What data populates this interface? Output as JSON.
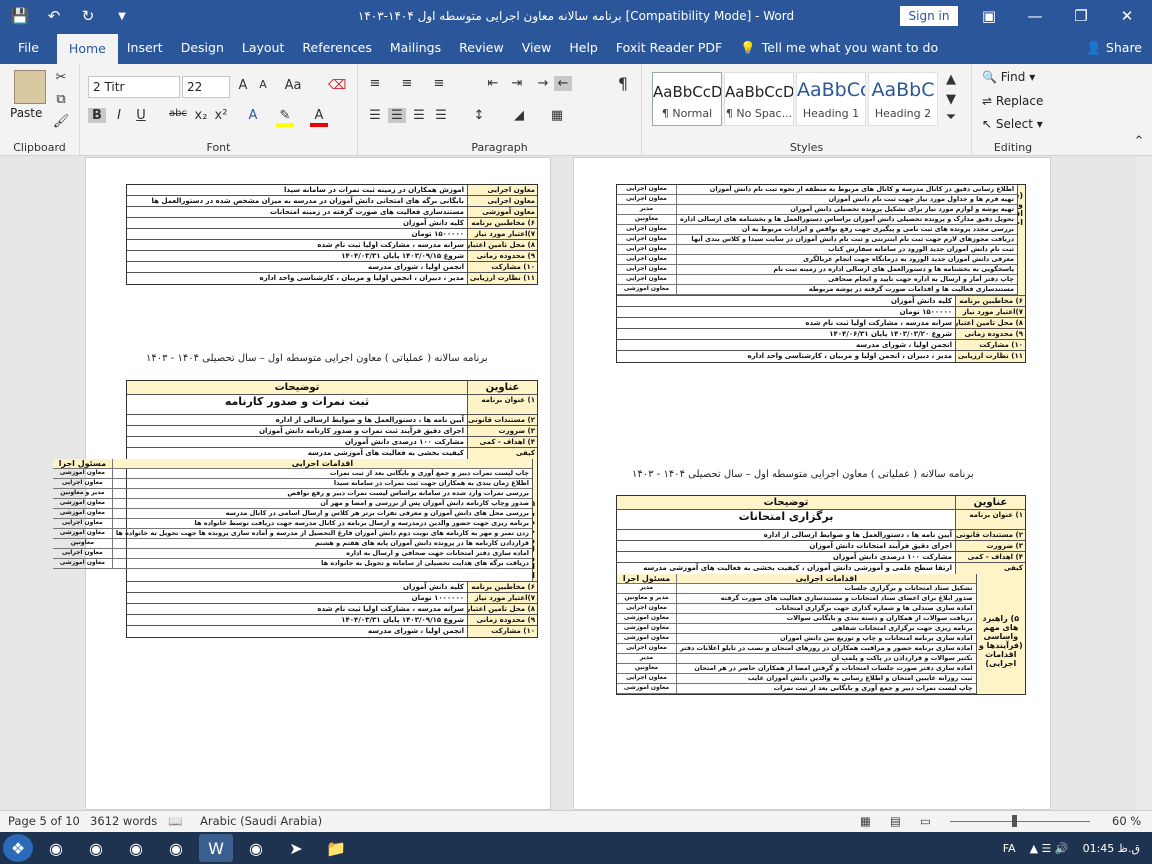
{
  "titlebar": {
    "title": "برنامه سالانه معاون اجرایی متوسطه اول ۱۴۰۴-۱۴۰۳ [Compatibility Mode]  -  Word",
    "signin": "Sign in",
    "icons": [
      "save-icon",
      "undo-icon",
      "redo-icon",
      "customize-icon"
    ]
  },
  "tabs": [
    "File",
    "Home",
    "Insert",
    "Design",
    "Layout",
    "References",
    "Mailings",
    "Review",
    "View",
    "Help",
    "Foxit Reader PDF"
  ],
  "tellme": "Tell me what you want to do",
  "share": "Share",
  "ribbon": {
    "clipboard": {
      "label": "Clipboard",
      "paste": "Paste"
    },
    "font": {
      "label": "Font",
      "family": "2  Titr",
      "size": "22",
      "buttons": [
        "B",
        "I",
        "U",
        "abc",
        "x₂",
        "x²",
        "Aa"
      ]
    },
    "paragraph": {
      "label": "Paragraph",
      "pilcrow": "¶"
    },
    "styles": {
      "label": "Styles",
      "tiles": [
        {
          "preview": "AaBbCcDc",
          "name": "¶ Normal"
        },
        {
          "preview": "AaBbCcDc",
          "name": "¶ No Spac..."
        },
        {
          "preview": "AaBbCc",
          "name": "Heading 1"
        },
        {
          "preview": "AaBbC",
          "name": "Heading 2"
        }
      ]
    },
    "editing": {
      "label": "Editing",
      "find": "Find",
      "replace": "Replace",
      "select": "Select"
    }
  },
  "left_page": {
    "top_table": [
      {
        "k": "معاون اجرایی",
        "v": "اموزش همکاران در زمینه ثبت نمرات در سامانه سیدا"
      },
      {
        "k": "معاون اجرایی",
        "v": "بایگانی برگه های امتحانی دانش آموزان در مدرسه به میزان مشخص شده در دستورالعمل ها"
      },
      {
        "k": "معاون آموزشی",
        "v": "مستندسازی فعالیت های صورت گرفته در زمینه امتحانات"
      },
      {
        "k": "۶) مخاطبین برنامه",
        "v": "کلیه دانش آموزان"
      },
      {
        "k": "۷)اعتبار مورد نیاز",
        "v": "۱۵۰۰۰۰۰ تومان"
      },
      {
        "k": "۸) محل تامین اعتبار",
        "v": "سرانه مدرسه ، مشارکت اولیا ثبت نام شده"
      },
      {
        "k": "۹) محدوده زمانی",
        "v": "شروع ۱۴۰۳/۰۹/۱۵   پایان ۱۴۰۴/۰۳/۳۱"
      },
      {
        "k": "۱۰) مشارکت",
        "v": "انجمن اولیا ، شورای مدرسه"
      },
      {
        "k": "۱۱) نظارت ارزیابی",
        "v": "مدیر ، دبیران ، انجمن اولیا و مربیان ، کارشناسی واحد اداره"
      }
    ],
    "caption": "برنامه سالانه ( عملیاتی ) معاون اجرایی متوسطه اول – سال تحصیلی ۱۴۰۴ - ۱۴۰۳",
    "main_table": {
      "h1": "عناوین",
      "h2": "توضیحات",
      "title_key": "۱) عنوان برنامه",
      "title_val": "ثبت نمرات و صدور کارنامه",
      "rows": [
        {
          "k": "۲) مستندات قانونی",
          "v": "آیین نامه ها ، دستورالعمل ها و ضوابط ارسالی از اداره"
        },
        {
          "k": "۳) ضرورت",
          "v": "اجرای دقیق فرآیند ثبت نمرات و صدور کارنامه دانش آموزان"
        },
        {
          "k": "۴) اهداف - کمی",
          "v": "مشارکت ۱۰۰ درصدی دانش آموزان"
        },
        {
          "k": "کیفی",
          "v": "کیفیت بخشی به فعالیت های آموزشی مدرسه"
        }
      ],
      "act_head": "اقدامات اجرایی",
      "resp_head": "مسئول اجرا",
      "section": "۵) راهبرد های مهم واساسی (فرآیندها و اقدامات اجرایی)",
      "acts": [
        {
          "a": "چاپ لیست نمرات دبیر و جمع آوری و بایگانی بعد از ثبت نمرات",
          "r": "معاون آموزشی"
        },
        {
          "a": "اطلاع زمان بندی به همکاران جهت ثبت نمرات در سامانه سیدا",
          "r": "معاون اجرایی"
        },
        {
          "a": "بررسی نمرات وارد شده در سامانه براساس لیست نمرات دبیر و رفع نواقص",
          "r": "مدیر و معاونین"
        },
        {
          "a": "صدور وچاپ کارنامه دانش آموزان پس از بررسی و امضا و مهر آن",
          "r": "معاون آموزشی"
        },
        {
          "a": "بررسی محل های دانش آموزان و معرفی نفرات برتر هر کلاس و ارسال اسامی در کانال مدرسه",
          "r": "معاون آموزشی"
        },
        {
          "a": "برنامه ریزی جهت حضور والدین درمدرسه و ارسال برنامه در کانال مدرسه جهت دریافت توسط خانواده ها",
          "r": "معاون اجرایی"
        },
        {
          "a": "زدن تمبر و مهر به کارنامه های نوبت دوم دانش آموزان فارغ التحصیل از مدرسه و آماده سازی پرونده ها جهت تحویل به خانواده ها",
          "r": "معاون آموزشی"
        },
        {
          "a": "قراردادن کارنامه ها در پرونده دانش آموزان پایه های هفتم و هشتم",
          "r": "معاونین"
        },
        {
          "a": "اماده سازی دفتر امتحانات جهت صحافی و ارسال به اداره",
          "r": "معاون اجرایی"
        },
        {
          "a": "دریافت برگه های هدایت تحصیلی از سامانه و تحویل به خانواده ها",
          "r": "معاون آموزشی"
        }
      ],
      "tail": [
        {
          "k": "۶) مخاطبین برنامه",
          "v": "کلیه دانش آموزان"
        },
        {
          "k": "۷)اعتبار مورد نیاز",
          "v": "۱۰۰۰۰۰۰ تومان"
        },
        {
          "k": "۸) محل تامین اعتبار",
          "v": "سرانه مدرسه ، مشارکت اولیا ثبت نام شده"
        },
        {
          "k": "۹) محدوده زمانی",
          "v": "شروع ۱۴۰۳/۰۹/۱۵   پایان ۱۴۰۴/۰۳/۳۱"
        },
        {
          "k": "۱۰) مشارکت",
          "v": "انجمن اولیا ، شورای مدرسه"
        }
      ]
    }
  },
  "right_page": {
    "section": "(فرآیندها و اقدامات اجرایی)",
    "top_acts": [
      {
        "a": "اطلاع رسانی دقیق در کانال مدرسه و کانال های مربوط به منطقه از نحوه ثبت نام دانش آموزان",
        "r": "معاون اجرایی"
      },
      {
        "a": "تهیه فرم ها و جداول مورد نیاز جهت ثبت نام دانش آموزان",
        "r": "معاون اجرایی"
      },
      {
        "a": "تهیه پوشه و لوازم مورد نیاز برای تشکیل پرونده تحصیلی دانش آموزان",
        "r": "مدیر"
      },
      {
        "a": "تحویل دقیق مدارک و پرونده تحصیلی دانش آموزان براساس دستورالعمل ها و بخشنامه های ارسالی اداره",
        "r": "معاونین"
      },
      {
        "a": "بررسی مجدد پرونده های ثبت نامی و پیگیری جهت رفع نواقص و ایرادات مربوط به آن",
        "r": "معاون اجرایی"
      },
      {
        "a": "دریافت مجوزهای لازم جهت ثبت نام اینترنتی و ثبت نام دانش آموزان در سایت سیدا و کلاس بندی آنها",
        "r": "معاون اجرایی"
      },
      {
        "a": "ثبت نام دانش آموزان جدید الورود در سامانه سفارش کتاب",
        "r": "معاون اجرایی"
      },
      {
        "a": "معرفی دانش آموزان جدید الورود به درمانگاه جهت انجام غربالگری",
        "r": "معاون اجرایی"
      },
      {
        "a": "پاسخگویی به بخشنامه ها و دستورالعمل های ارسالی اداره در زمینه ثبت نام",
        "r": "معاون اجرایی"
      },
      {
        "a": "چاپ دفتر آمار و ارسال به اداره جهت تایید و انجام صحافی",
        "r": "معاون اجرایی"
      },
      {
        "a": "مستندسازی فعالیت ها و اقدامات صورت گرفته در پوشه مربوطه",
        "r": "معاون آموزشی"
      }
    ],
    "info": [
      {
        "k": "۶) مخاطبین برنامه",
        "v": "کلیه دانش آموزان"
      },
      {
        "k": "۷)اعتبار مورد نیاز",
        "v": "۱۵۰۰۰۰۰ تومان"
      },
      {
        "k": "۸) محل تامین اعتبار",
        "v": "سرانه مدرسه ، مشارکت اولیا ثبت نام شده"
      },
      {
        "k": "۹) محدوده زمانی",
        "v": "شروع ۱۴۰۳/۰۳/۲۰   پایان ۱۴۰۴/۰۶/۳۱"
      },
      {
        "k": "۱۰) مشارکت",
        "v": "انجمن اولیا ، شورای مدرسه"
      },
      {
        "k": "۱۱) نظارت ارزیابی",
        "v": "مدیر ، دبیران ، انجمن اولیا و مربیان ، کارشناسی واحد اداره"
      }
    ],
    "caption": "برنامه سالانه ( عملیاتی ) معاون اجرایی متوسطه اول – سال تحصیلی ۱۴۰۴ - ۱۴۰۳",
    "main_table": {
      "h1": "عناوین",
      "h2": "توضیحات",
      "title_key": "۱) عنوان برنامه",
      "title_val": "برگزاری امتحانات",
      "rows": [
        {
          "k": "۲) مستندات قانونی",
          "v": "آیین نامه ها ، دستورالعمل ها و ضوابط ارسالی از اداره"
        },
        {
          "k": "۳) ضرورت",
          "v": "اجرای دقیق فرآیند امتحانات دانش آموزان"
        },
        {
          "k": "۴) اهداف - کمی",
          "v": "مشارکت ۱۰۰ درصدی دانش آموزان"
        },
        {
          "k": "کیفی",
          "v": "ارتقا سطح علمی و آموزشی دانش آموزان ، کیفیت بخشی به فعالیت های آموزشی مدرسه"
        }
      ],
      "act_head": "اقدامات اجرایی",
      "resp_head": "مسئول اجرا",
      "section": "۵) راهبرد های مهم واساسی (فرآیندها و اقدامات اجرایی)",
      "acts": [
        {
          "a": "تشکیل ستاد امتحانات و برگزاری جلسات",
          "r": "مدیر"
        },
        {
          "a": "صدور ابلاغ برای اعضای ستاد امتحانات و مستندسازی فعالیت های صورت گرفته",
          "r": "مدیر و معاونین"
        },
        {
          "a": "اماده سازی صندلی ها و شماره گذاری جهت برگزاری امتحانات",
          "r": "معاون اجرایی"
        },
        {
          "a": "دریافت سوالات از همکاران و دسته بندی و بایگانی سوالات",
          "r": "معاون آموزشی"
        },
        {
          "a": "برنامه ریزی جهت برگزاری امتحانات شفاهی",
          "r": "معاون آموزشی"
        },
        {
          "a": "اماده سازی برنامه امتحانات و چاپ و توزیع بین دانش اموزان",
          "r": "معاون آموزشی"
        },
        {
          "a": "اماده سازی برنامه حضور و مراقبت همکاران در روزهای امتحان و نصب در تابلو اعلانات دفتر",
          "r": "معاون اجرایی"
        },
        {
          "a": "تکثیر سوالات و قراردادن در پاکت و پلمپ آن",
          "r": "مدیر"
        },
        {
          "a": "اماده سازی دفتر صورت جلسات امتحانات و گرفتن امضا از همکاران حاضر در هر امتحان",
          "r": "معاونین"
        },
        {
          "a": "ثبت روزانه غایبین امتحان و اطلاع رسانی به والدین دانش آموزان غایب",
          "r": "معاون اجرایی"
        },
        {
          "a": "چاپ لیست نمرات دبیر و جمع آوری و بایگانی بعد از ثبت نمرات",
          "r": "معاون آموزشی"
        }
      ]
    }
  },
  "status": {
    "page": "Page 5 of 10",
    "words": "3612 words",
    "language": "Arabic (Saudi Arabia)",
    "zoom": "60 %"
  },
  "taskbar": {
    "lang": "FA",
    "time": "ق.ظ 01:45"
  }
}
